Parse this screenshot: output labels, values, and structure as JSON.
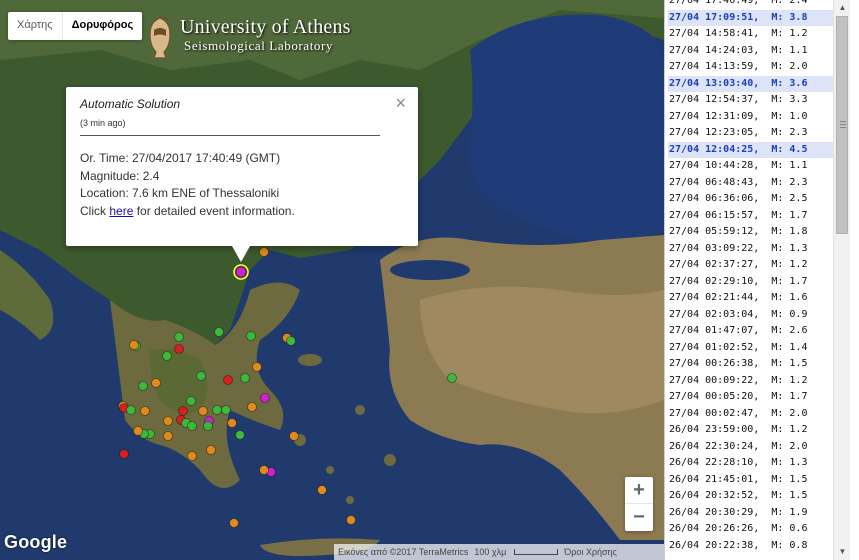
{
  "map_type": {
    "map_label": "Χάρτης",
    "satellite_label": "Δορυφόρος",
    "selected": "satellite"
  },
  "logo": {
    "line1": "University of Athens",
    "line2": "Seismological Laboratory"
  },
  "info_window": {
    "title": "Automatic Solution",
    "ago": "(3 min ago)",
    "close_glyph": "×",
    "origin_time": "Or. Time: 27/04/2017 17:40:49 (GMT)",
    "magnitude": "Magnitude: 2.4",
    "location": "Location: 7.6 km ENE of Thessaloniki",
    "click_prefix": "Click ",
    "link_text": "here",
    "click_suffix": " for detailed event information."
  },
  "zoom": {
    "in": "+",
    "out": "−"
  },
  "google_logo": "Google",
  "attribution": {
    "imagery": "Εικόνες από ©2017 TerraMetrics",
    "scale": "100 χλμ",
    "terms": "Όροι Χρήσης"
  },
  "colors": {
    "marker_green": "#3db83d",
    "marker_orange": "#e08a1e",
    "marker_red": "#d42020",
    "marker_magenta": "#d021d0",
    "highlight_text": "#1a3fc0"
  },
  "markers": [
    {
      "c": "magenta",
      "big": true
    },
    {
      "c": "orange"
    },
    {
      "c": "green"
    },
    {
      "c": "green"
    },
    {
      "c": "green"
    },
    {
      "c": "orange"
    },
    {
      "c": "red"
    },
    {
      "c": "green"
    },
    {
      "c": "green"
    },
    {
      "c": "orange"
    },
    {
      "c": "green"
    },
    {
      "c": "orange"
    },
    {
      "c": "green"
    },
    {
      "c": "red"
    },
    {
      "c": "green"
    },
    {
      "c": "orange"
    },
    {
      "c": "red"
    },
    {
      "c": "orange"
    },
    {
      "c": "red"
    },
    {
      "c": "green"
    },
    {
      "c": "green"
    },
    {
      "c": "red"
    },
    {
      "c": "orange"
    },
    {
      "c": "green"
    },
    {
      "c": "magenta"
    },
    {
      "c": "orange"
    },
    {
      "c": "green"
    },
    {
      "c": "magenta"
    },
    {
      "c": "green"
    },
    {
      "c": "orange"
    },
    {
      "c": "green"
    },
    {
      "c": "green"
    },
    {
      "c": "orange"
    },
    {
      "c": "red"
    },
    {
      "c": "green"
    },
    {
      "c": "orange"
    },
    {
      "c": "magenta"
    },
    {
      "c": "orange"
    },
    {
      "c": "orange"
    },
    {
      "c": "orange"
    },
    {
      "c": "green"
    },
    {
      "c": "orange"
    },
    {
      "c": "orange"
    },
    {
      "c": "green"
    },
    {
      "c": "orange"
    },
    {
      "c": "orange"
    },
    {
      "c": "orange"
    },
    {
      "c": "green"
    },
    {
      "c": "green"
    },
    {
      "c": "orange"
    }
  ],
  "earthquakes": [
    {
      "text": "27/04 17:40:49,  M: 2.4",
      "highlight": false
    },
    {
      "text": "27/04 17:09:51,  M: 3.8",
      "highlight": true
    },
    {
      "text": "27/04 14:58:41,  M: 1.2",
      "highlight": false
    },
    {
      "text": "27/04 14:24:03,  M: 1.1",
      "highlight": false
    },
    {
      "text": "27/04 14:13:59,  M: 2.0",
      "highlight": false
    },
    {
      "text": "27/04 13:03:40,  M: 3.6",
      "highlight": true
    },
    {
      "text": "27/04 12:54:37,  M: 3.3",
      "highlight": false
    },
    {
      "text": "27/04 12:31:09,  M: 1.0",
      "highlight": false
    },
    {
      "text": "27/04 12:23:05,  M: 2.3",
      "highlight": false
    },
    {
      "text": "27/04 12:04:25,  M: 4.5",
      "highlight": true
    },
    {
      "text": "27/04 10:44:28,  M: 1.1",
      "highlight": false
    },
    {
      "text": "27/04 06:48:43,  M: 2.3",
      "highlight": false
    },
    {
      "text": "27/04 06:36:06,  M: 2.5",
      "highlight": false
    },
    {
      "text": "27/04 06:15:57,  M: 1.7",
      "highlight": false
    },
    {
      "text": "27/04 05:59:12,  M: 1.8",
      "highlight": false
    },
    {
      "text": "27/04 03:09:22,  M: 1.3",
      "highlight": false
    },
    {
      "text": "27/04 02:37:27,  M: 1.2",
      "highlight": false
    },
    {
      "text": "27/04 02:29:10,  M: 1.7",
      "highlight": false
    },
    {
      "text": "27/04 02:21:44,  M: 1.6",
      "highlight": false
    },
    {
      "text": "27/04 02:03:04,  M: 0.9",
      "highlight": false
    },
    {
      "text": "27/04 01:47:07,  M: 2.6",
      "highlight": false
    },
    {
      "text": "27/04 01:02:52,  M: 1.4",
      "highlight": false
    },
    {
      "text": "27/04 00:26:38,  M: 1.5",
      "highlight": false
    },
    {
      "text": "27/04 00:09:22,  M: 1.2",
      "highlight": false
    },
    {
      "text": "27/04 00:05:20,  M: 1.7",
      "highlight": false
    },
    {
      "text": "27/04 00:02:47,  M: 2.0",
      "highlight": false
    },
    {
      "text": "26/04 23:59:00,  M: 1.2",
      "highlight": false
    },
    {
      "text": "26/04 22:30:24,  M: 2.0",
      "highlight": false
    },
    {
      "text": "26/04 22:28:10,  M: 1.3",
      "highlight": false
    },
    {
      "text": "26/04 21:45:01,  M: 1.5",
      "highlight": false
    },
    {
      "text": "26/04 20:32:52,  M: 1.5",
      "highlight": false
    },
    {
      "text": "26/04 20:30:29,  M: 1.9",
      "highlight": false
    },
    {
      "text": "26/04 20:26:26,  M: 0.6",
      "highlight": false
    },
    {
      "text": "26/04 20:22:38,  M: 0.8",
      "highlight": false
    }
  ]
}
